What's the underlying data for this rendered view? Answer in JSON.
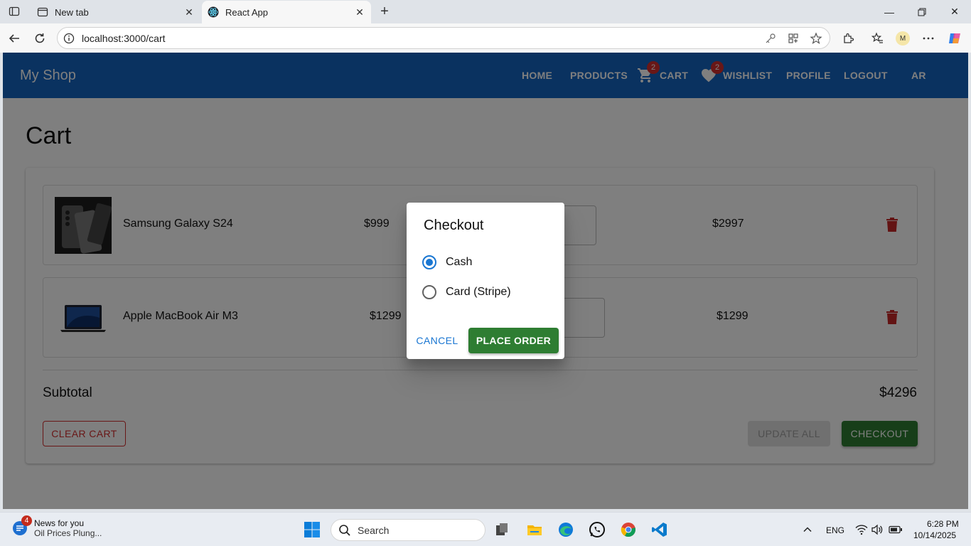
{
  "browser": {
    "tabs": [
      {
        "label": "New tab",
        "active": false
      },
      {
        "label": "React App",
        "active": true
      }
    ],
    "url": "localhost:3000/cart",
    "profile_initial": "M"
  },
  "app": {
    "brand": "My Shop",
    "nav": {
      "home": "HOME",
      "products": "PRODUCTS",
      "cart": "CART",
      "cart_count": "2",
      "wishlist": "WISHLIST",
      "wishlist_count": "2",
      "profile": "PROFILE",
      "logout": "LOGOUT",
      "lang": "AR"
    },
    "colors": {
      "primary": "#1565c0",
      "success": "#2e7d32",
      "danger": "#d32f2f"
    }
  },
  "cart": {
    "title": "Cart",
    "items": [
      {
        "name": "Samsung Galaxy S24",
        "price": "$999",
        "total": "$2997"
      },
      {
        "name": "Apple MacBook Air M3",
        "price": "$1299",
        "total": "$1299"
      }
    ],
    "subtotal_label": "Subtotal",
    "subtotal_value": "$4296",
    "clear_label": "CLEAR CART",
    "update_label": "UPDATE ALL",
    "checkout_label": "CHECKOUT"
  },
  "dialog": {
    "title": "Checkout",
    "options": [
      {
        "label": "Cash",
        "selected": true
      },
      {
        "label": "Card (Stripe)",
        "selected": false
      }
    ],
    "cancel_label": "CANCEL",
    "place_label": "PLACE ORDER"
  },
  "taskbar": {
    "news_count": "4",
    "news_title": "News for you",
    "news_sub": "Oil Prices Plung...",
    "search_label": "Search",
    "lang": "ENG",
    "time": "6:28 PM",
    "date": "10/14/2025"
  }
}
